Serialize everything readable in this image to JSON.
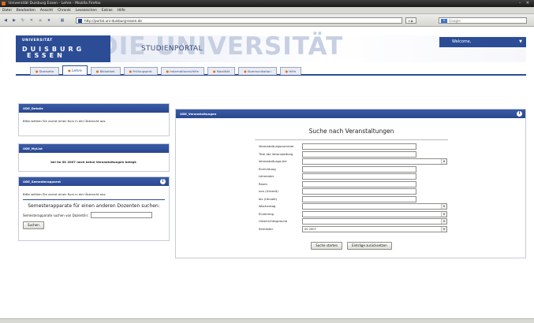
{
  "window": {
    "title": "Universität Duisburg Essen - Lehre - Mozilla Firefox"
  },
  "menubar": [
    "Datei",
    "Bearbeiten",
    "Ansicht",
    "Chronik",
    "Lesezeichen",
    "Extras",
    "Hilfe"
  ],
  "browser": {
    "url": "http://portal.uni-duisburg-essen.de",
    "search_placeholder": "Google"
  },
  "header": {
    "logo_line1": "UNIVERSITÄT",
    "logo_line2": "DUISBURG",
    "logo_line3": "ESSEN",
    "big_text": "DIE UNIVERSITÄT",
    "portal_title": "STUDIENPORTAL",
    "welcome": "Welcome,"
  },
  "tabs": [
    {
      "label": "Startseite",
      "active": false
    },
    {
      "label": "Lehre",
      "active": true
    },
    {
      "label": "Bibliothek",
      "active": false
    },
    {
      "label": "Prüfungsamt",
      "active": false
    },
    {
      "label": "Informationen/Hilfe",
      "active": false
    },
    {
      "label": "Mobilität",
      "active": false
    },
    {
      "label": "Kommunikation",
      "active": false
    },
    {
      "label": "Hilfe",
      "active": false
    }
  ],
  "panels": {
    "details": {
      "title": "UDE_Details",
      "text": "Bitte wählen Sie zuerst einen Kurs in der Übersicht aus."
    },
    "myl": {
      "title": "UDE_MyList",
      "text": "bei im SS 2007 noch keine Veranstaltungen belegt."
    },
    "semester": {
      "title": "UDE_Semesterapparat",
      "text": "Bitte wählen Sie zuerst einen Kurs in der Übersicht aus.",
      "subtitle": "Semesterapparate für einen anderen Dozenten suchen:",
      "input_label": "Semesterapparate suchen von Dozent/in:",
      "button": "Suchen"
    },
    "search": {
      "title": "UDE_Veranstaltungen",
      "heading": "Suche nach Veranstaltungen",
      "fields": [
        {
          "label": "Veranstaltungsnummer",
          "type": "text",
          "value": ""
        },
        {
          "label": "Titel der Veranstaltung",
          "type": "text",
          "value": ""
        },
        {
          "label": "Veranstaltungs-Art",
          "type": "select",
          "value": ""
        },
        {
          "label": "Einrichtung",
          "type": "text",
          "value": ""
        },
        {
          "label": "Lehrender",
          "type": "text",
          "value": ""
        },
        {
          "label": "Raum",
          "type": "text",
          "value": ""
        },
        {
          "label": "von (Uhrzeit)",
          "type": "text",
          "value": ""
        },
        {
          "label": "bis (Uhrzeit)",
          "type": "text",
          "value": ""
        },
        {
          "label": "Wochentag",
          "type": "select",
          "value": ""
        },
        {
          "label": "ELearning",
          "type": "select",
          "value": ""
        },
        {
          "label": "Unterrichtssprache",
          "type": "select",
          "value": ""
        },
        {
          "label": "Semester",
          "type": "select",
          "value": "SS 2007"
        }
      ],
      "btn_search": "Suche starten",
      "btn_reset": "Einträge zurücksetzen"
    }
  }
}
